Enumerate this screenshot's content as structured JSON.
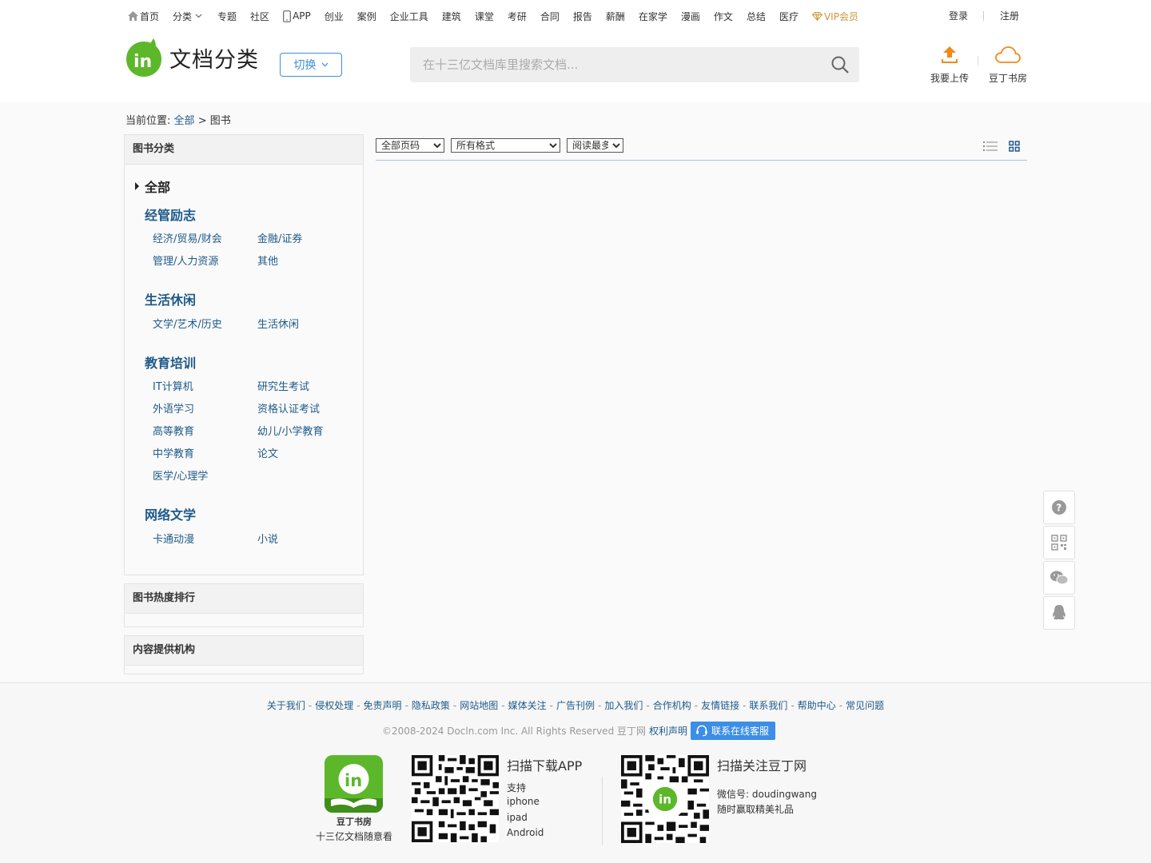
{
  "topnav": {
    "items": [
      "首页",
      "分类",
      "专题",
      "社区",
      "APP",
      "创业",
      "案例",
      "企业工具",
      "建筑",
      "课堂",
      "考研",
      "合同",
      "报告",
      "薪酬",
      "在家学",
      "漫画",
      "作文",
      "总结",
      "医疗"
    ],
    "vip": "VIP会员",
    "login": "登录",
    "register": "注册"
  },
  "header": {
    "logo_text": "文档分类",
    "switch_label": "切换",
    "search_placeholder": "在十三亿文档库里搜索文档...",
    "upload_label": "我要上传",
    "bookroom_label": "豆丁书房"
  },
  "breadcrumb": {
    "prefix": "当前位置:",
    "root": "全部",
    "sep": ">",
    "current": "图书"
  },
  "sidebar": {
    "panel_title": "图书分类",
    "all_label": "全部",
    "groups": [
      {
        "title": "经管励志",
        "items": [
          "经济/贸易/财会",
          "金融/证券",
          "管理/人力资源",
          "其他"
        ]
      },
      {
        "title": "生活休闲",
        "items": [
          "文学/艺术/历史",
          "生活休闲"
        ]
      },
      {
        "title": "教育培训",
        "items": [
          "IT计算机",
          "研究生考试",
          "外语学习",
          "资格认证考试",
          "高等教育",
          "幼儿/小学教育",
          "中学教育",
          "论文",
          "医学/心理学"
        ]
      },
      {
        "title": "网络文学",
        "items": [
          "卡通动漫",
          "小说"
        ]
      }
    ],
    "hot_title": "图书热度排行",
    "provider_title": "内容提供机构"
  },
  "filters": {
    "pages": "全部页码",
    "format": "所有格式",
    "sort": "阅读最多"
  },
  "footer": {
    "links": [
      "关于我们",
      "侵权处理",
      "免责声明",
      "隐私政策",
      "网站地图",
      "媒体关注",
      "广告刊例",
      "加入我们",
      "合作机构",
      "友情链接",
      "联系我们",
      "帮助中心",
      "常见问题"
    ],
    "copyright": "©2008-2024 Docln.com Inc. All Rights Reserved 豆丁网",
    "rights": "权利声明",
    "service": "联系在线客服",
    "app_name": "豆丁书房",
    "app_slogan": "十三亿文档随意看",
    "qr1_title": "扫描下载APP",
    "qr1_lines": [
      "支持",
      "iphone",
      "ipad",
      "Android"
    ],
    "qr2_title": "扫描关注豆丁网",
    "qr2_lines": [
      "微信号: doudingwang",
      "随时赢取精美礼品"
    ]
  },
  "colors": {
    "link": "#1f5a8a",
    "accent_blue": "#3a8fd8",
    "upload_orange": "#f08a1c",
    "logo_green": "#5cb82a"
  }
}
